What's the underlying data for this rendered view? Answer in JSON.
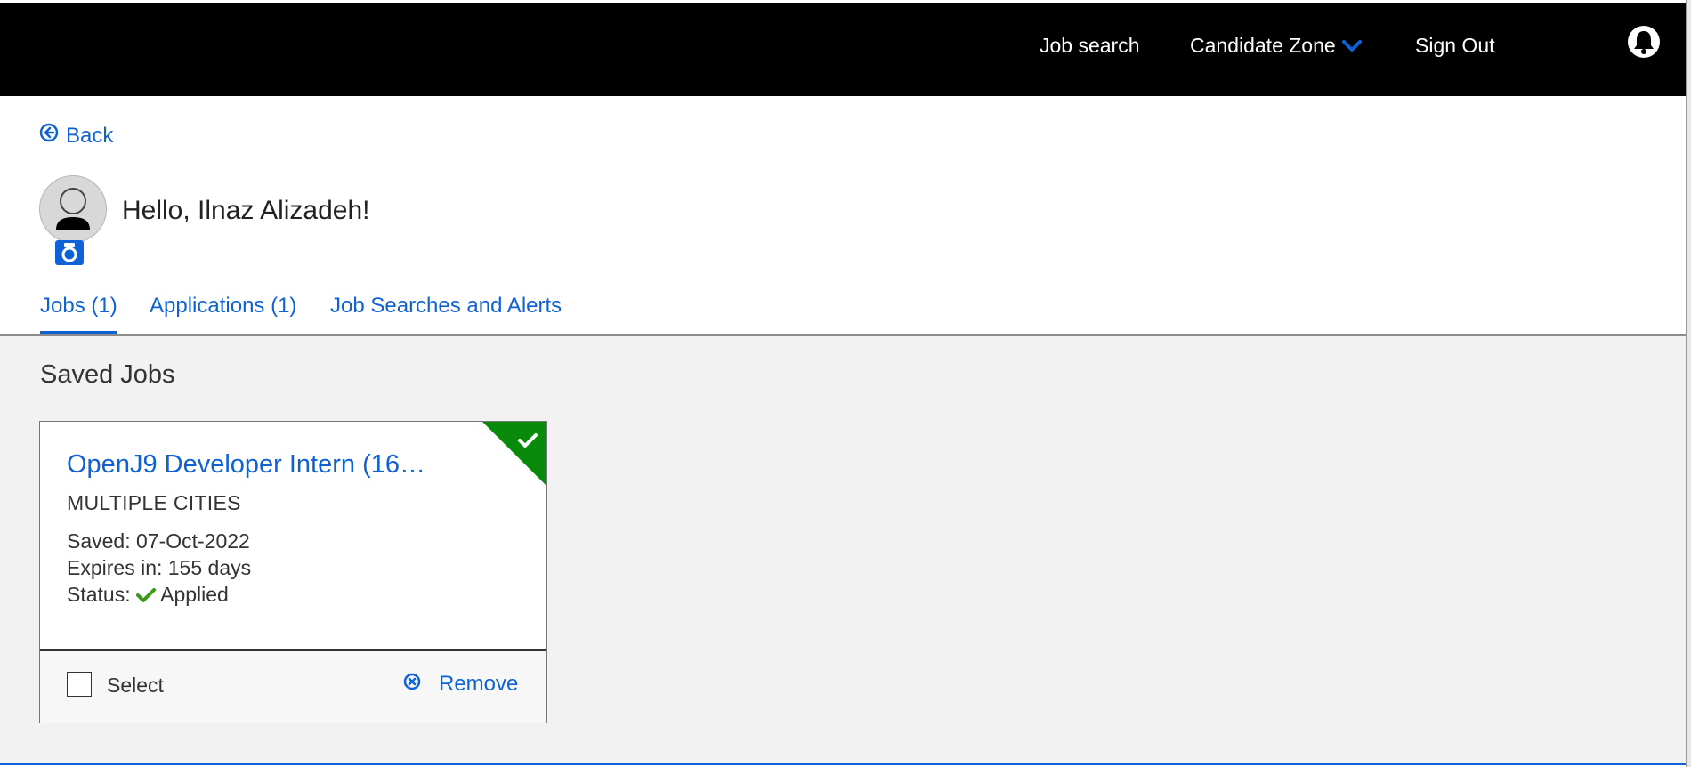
{
  "header": {
    "nav": [
      {
        "label": "Job search"
      },
      {
        "label": "Candidate Zone"
      },
      {
        "label": "Sign Out"
      }
    ]
  },
  "back": {
    "label": "Back"
  },
  "profile": {
    "greeting": "Hello, Ilnaz Alizadeh!"
  },
  "tabs": [
    {
      "label": "Jobs (1)",
      "active": true
    },
    {
      "label": "Applications (1)"
    },
    {
      "label": "Job Searches and Alerts"
    }
  ],
  "saved_jobs": {
    "title": "Saved Jobs",
    "items": [
      {
        "title": "OpenJ9 Developer Intern (16…",
        "location": "MULTIPLE CITIES",
        "saved_text": "Saved: 07-Oct-2022",
        "expires_text": "Expires in: 155 days",
        "status_label": "Status:",
        "status_value": "Applied",
        "select_label": "Select",
        "remove_label": "Remove"
      }
    ]
  },
  "colors": {
    "accent": "#0f62d6",
    "topbar": "#000000",
    "applied_green": "#0a8a0a",
    "content_bg": "#f2f2f2"
  }
}
